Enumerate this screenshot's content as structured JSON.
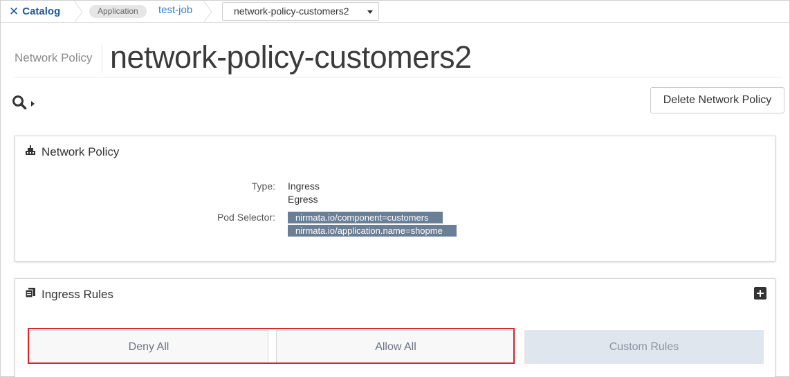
{
  "breadcrumb": {
    "catalog_label": "Catalog",
    "application_badge": "Application",
    "job_label": "test-job",
    "selected_policy": "network-policy-customers2"
  },
  "header": {
    "kind_label": "Network Policy",
    "title": "network-policy-customers2"
  },
  "toolbar": {
    "delete_label": "Delete Network Policy"
  },
  "policy_panel": {
    "heading": "Network Policy",
    "type_label": "Type:",
    "types": [
      "Ingress",
      "Egress"
    ],
    "pod_selector_label": "Pod Selector:",
    "pod_selectors": [
      "nirmata.io/component=customers",
      "nirmata.io/application.name=shopme"
    ]
  },
  "ingress_panel": {
    "heading": "Ingress Rules",
    "buttons": {
      "deny_all": "Deny All",
      "allow_all": "Allow All",
      "custom_rules": "Custom Rules"
    }
  },
  "icons": {
    "catalog": "close-x-icon",
    "search": "search-icon",
    "expand": "caret-right-icon",
    "select_caret": "caret-down-icon",
    "policy": "network-policy-icon",
    "ingress": "ingress-rules-icon",
    "add": "plus-square-icon"
  },
  "colors": {
    "brand": "#1f5a99",
    "tag_bg": "#6a7f95",
    "highlight": "#d9272e",
    "custom_btn_bg": "#dfe6ed"
  }
}
